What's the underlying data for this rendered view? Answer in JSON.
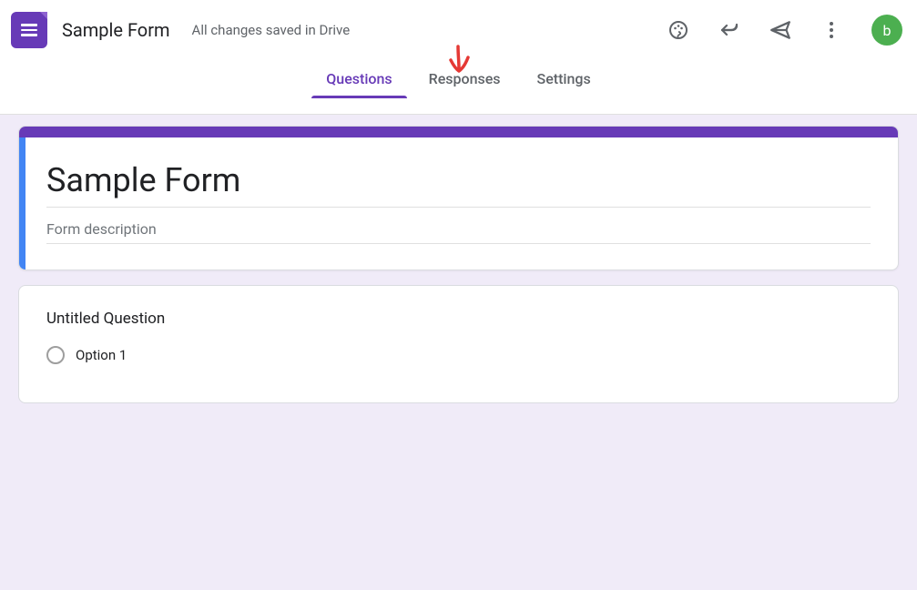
{
  "header": {
    "doc_title": "Sample Form",
    "save_status": "All changes saved in Drive",
    "avatar_letter": "b"
  },
  "tabs": {
    "questions": "Questions",
    "responses": "Responses",
    "settings": "Settings",
    "active": "questions"
  },
  "form": {
    "title": "Sample Form",
    "description_placeholder": "Form description",
    "description_value": ""
  },
  "questions": [
    {
      "title": "Untitled Question",
      "options": [
        "Option 1"
      ]
    }
  ],
  "colors": {
    "primary": "#673ab7",
    "accent": "#4285f4",
    "avatar_bg": "#4caf50"
  }
}
